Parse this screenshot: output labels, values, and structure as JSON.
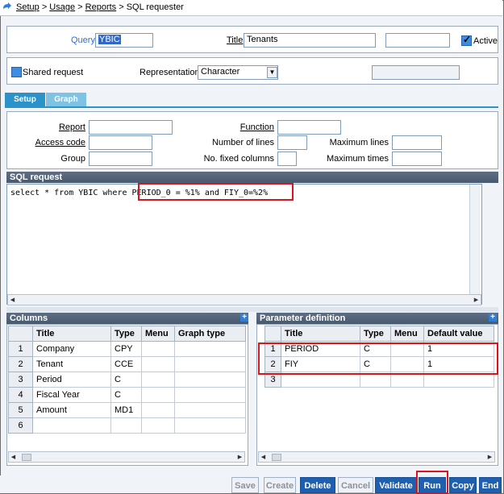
{
  "breadcrumb": {
    "items": [
      "Setup",
      "Usage",
      "Reports"
    ],
    "current": "SQL requester",
    "separator": " > "
  },
  "header": {
    "query_label": "Query",
    "query_value": "YBIC",
    "title_label": "Title",
    "title_value": "Tenants",
    "extra_value": "",
    "active_label": "Active",
    "active_checked": true,
    "shared_label": "Shared request",
    "shared_checked": false,
    "representation_label": "Representation",
    "representation_value": "Character",
    "right_field_value": ""
  },
  "tabs": [
    {
      "label": "Setup",
      "active": true
    },
    {
      "label": "Graph",
      "active": false
    }
  ],
  "setup": {
    "report_label": "Report",
    "report_value": "",
    "access_code_label": "Access code",
    "access_code_value": "",
    "group_label": "Group",
    "group_value": "",
    "function_label": "Function",
    "function_value": "",
    "number_of_lines_label": "Number of lines",
    "number_of_lines_value": "",
    "no_fixed_columns_label": "No. fixed columns",
    "no_fixed_columns_value": "",
    "maximum_lines_label": "Maximum lines",
    "maximum_lines_value": "",
    "maximum_times_label": "Maximum times",
    "maximum_times_value": ""
  },
  "sql": {
    "section_title": "SQL request",
    "prefix": "select * from YBIC where ",
    "highlighted": "PERIOD_0 = %1% and FIY_0=%2%"
  },
  "columns": {
    "section_title": "Columns",
    "headers": [
      "",
      "Title",
      "Type",
      "Menu",
      "Graph type"
    ],
    "rows": [
      [
        "1",
        "Company",
        "CPY",
        "",
        ""
      ],
      [
        "2",
        "Tenant",
        "CCE",
        "",
        ""
      ],
      [
        "3",
        "Period",
        "C",
        "",
        ""
      ],
      [
        "4",
        "Fiscal Year",
        "C",
        "",
        ""
      ],
      [
        "5",
        "Amount",
        "MD1",
        "",
        ""
      ],
      [
        "6",
        "",
        "",
        "",
        ""
      ]
    ]
  },
  "parameters": {
    "section_title": "Parameter definition",
    "headers": [
      "",
      "Title",
      "Type",
      "Menu",
      "Default value"
    ],
    "rows": [
      [
        "1",
        "PERIOD",
        "C",
        "",
        "1"
      ],
      [
        "2",
        "FIY",
        "C",
        "",
        "1"
      ],
      [
        "3",
        "",
        "",
        "",
        ""
      ]
    ]
  },
  "buttons": [
    {
      "label": "Save",
      "enabled": false
    },
    {
      "label": "Create",
      "enabled": false
    },
    {
      "label": "Delete",
      "enabled": true
    },
    {
      "label": "Cancel",
      "enabled": false
    },
    {
      "label": "Validate",
      "enabled": true
    },
    {
      "label": "Run",
      "enabled": true,
      "highlighted": true
    },
    {
      "label": "Copy",
      "enabled": true
    },
    {
      "label": "End",
      "enabled": true
    }
  ],
  "colors": {
    "accent": "#1f5fb0",
    "tab_active": "#2b93c9",
    "tab_inactive": "#7ec3e3",
    "highlight": "#d9141b",
    "section_header": "#55657a"
  }
}
